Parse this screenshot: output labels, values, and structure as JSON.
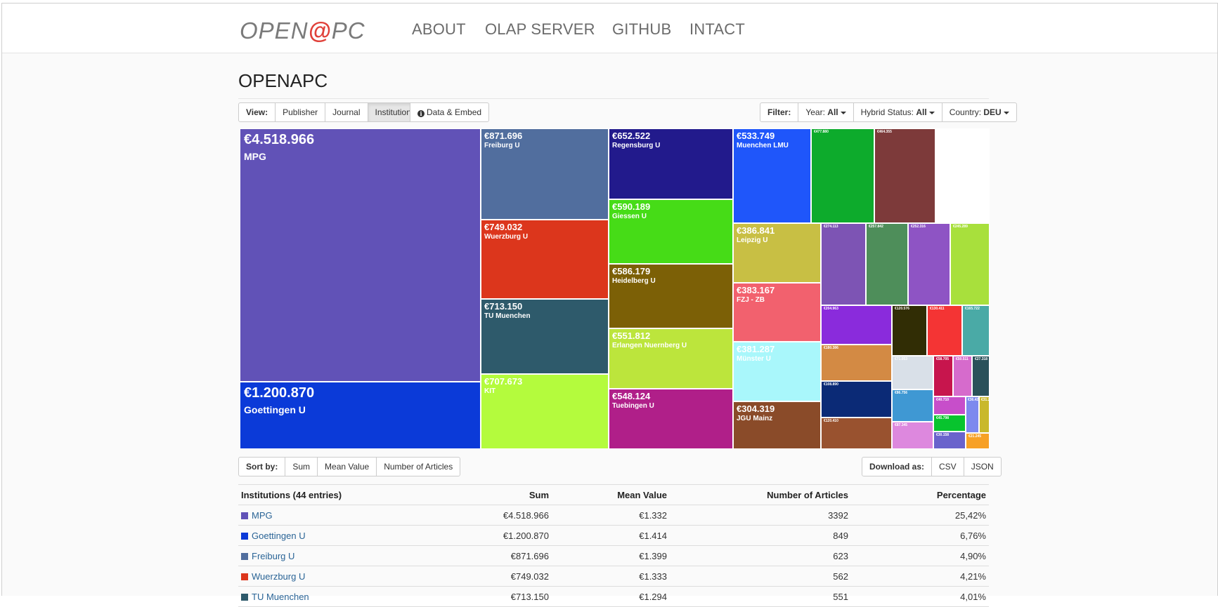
{
  "nav": {
    "logo_left": "OPEN",
    "logo_at": "@",
    "logo_right": "PC",
    "items": [
      "ABOUT",
      "OLAP SERVER",
      "GITHUB",
      "INTACT"
    ]
  },
  "page_title": "OPENAPC",
  "view": {
    "label": "View:",
    "buttons": [
      "Publisher",
      "Journal",
      "Institution"
    ],
    "active": "Institution",
    "data_embed": "Data & Embed"
  },
  "filter": {
    "label": "Filter:",
    "year": {
      "label": "Year:",
      "value": "All"
    },
    "hybrid": {
      "label": "Hybrid Status:",
      "value": "All"
    },
    "country": {
      "label": "Country:",
      "value": "DEU"
    }
  },
  "treemap": {
    "tiles": [
      {
        "amount": "€4.518.966",
        "name": "MPG",
        "color": "#6152b7"
      },
      {
        "amount": "€1.200.870",
        "name": "Goettingen U",
        "color": "#0b3ad8"
      },
      {
        "amount": "€871.696",
        "name": "Freiburg U",
        "color": "#516e9e"
      },
      {
        "amount": "€749.032",
        "name": "Wuerzburg U",
        "color": "#dc361c"
      },
      {
        "amount": "€713.150",
        "name": "TU Muenchen",
        "color": "#2e5a6b"
      },
      {
        "amount": "€707.673",
        "name": "KIT",
        "color": "#b4fb3d"
      },
      {
        "amount": "€652.522",
        "name": "Regensburg U",
        "color": "#221a8c"
      },
      {
        "amount": "€590.189",
        "name": "Giessen U",
        "color": "#46dc17"
      },
      {
        "amount": "€586.179",
        "name": "Heidelberg U",
        "color": "#7c6006"
      },
      {
        "amount": "€551.812",
        "name": "Erlangen Nuernberg U",
        "color": "#bce53c"
      },
      {
        "amount": "€548.124",
        "name": "Tuebingen U",
        "color": "#b01f89"
      },
      {
        "amount": "€533.749",
        "name": "Muenchen LMU",
        "color": "#1f56fa"
      },
      {
        "amount": "€477.880",
        "name": "",
        "color": "#0dab2c"
      },
      {
        "amount": "€464.355",
        "name": "",
        "color": "#7d3a3a"
      },
      {
        "amount": "€386.841",
        "name": "Leipzig U",
        "color": "#c8bf44"
      },
      {
        "amount": "€383.167",
        "name": "FZJ - ZB",
        "color": "#f2616e"
      },
      {
        "amount": "€381.287",
        "name": "Münster U",
        "color": "#a9f7fb"
      },
      {
        "amount": "€304.319",
        "name": "JGU Mainz",
        "color": "#8a4b29"
      },
      {
        "amount": "€274.113",
        "name": "",
        "color": "#7d54b4"
      },
      {
        "amount": "€257.842",
        "name": "",
        "color": "#4e8e5a"
      },
      {
        "amount": "€252.316",
        "name": "",
        "color": "#8e54c4"
      },
      {
        "amount": "€245.289",
        "name": "",
        "color": "#a8e03c"
      },
      {
        "amount": "€204.963",
        "name": "",
        "color": "#8a2bdc"
      },
      {
        "amount": "€120.576",
        "name": "",
        "color": "#312d05"
      },
      {
        "amount": "€130.411",
        "name": "",
        "color": "#f43434"
      },
      {
        "amount": "€165.722",
        "name": "",
        "color": "#4aaaa6"
      },
      {
        "amount": "€180.386",
        "name": "",
        "color": "#d38a44"
      },
      {
        "amount": "€108.890",
        "name": "",
        "color": "#0b2a76"
      },
      {
        "amount": "€120.410",
        "name": "",
        "color": "#99522f"
      },
      {
        "amount": "€71.053",
        "name": "",
        "color": "#d9e0e8"
      },
      {
        "amount": "€58.705",
        "name": "",
        "color": "#c7154d"
      },
      {
        "amount": "€50.511",
        "name": "",
        "color": "#d66bcc"
      },
      {
        "amount": "€27.318",
        "name": "",
        "color": "#2a515a"
      },
      {
        "amount": "€86.756",
        "name": "",
        "color": "#3f98d3"
      },
      {
        "amount": "€75.165",
        "name": "",
        "color": "#c57ad3"
      },
      {
        "amount": "€40.710",
        "name": "",
        "color": "#c74eca"
      },
      {
        "amount": "€45.798",
        "name": "",
        "color": "#08c42e"
      },
      {
        "amount": "€87.345",
        "name": "",
        "color": "#dd88de"
      },
      {
        "amount": "€30.158",
        "name": "",
        "color": "#6a63cc"
      },
      {
        "amount": "€36.429",
        "name": "",
        "color": "#7d89ee"
      },
      {
        "amount": "€31.230",
        "name": "",
        "color": "#c9b82b"
      },
      {
        "amount": "€32.105",
        "name": "",
        "color": "#e0d83a"
      },
      {
        "amount": "€21.245",
        "name": "",
        "color": "#f7a125"
      }
    ]
  },
  "sort": {
    "label": "Sort by:",
    "buttons": [
      "Sum",
      "Mean Value",
      "Number of Articles"
    ]
  },
  "download": {
    "label": "Download as:",
    "buttons": [
      "CSV",
      "JSON"
    ]
  },
  "table": {
    "headers": [
      "Institutions (44 entries)",
      "Sum",
      "Mean Value",
      "Number of Articles",
      "Percentage"
    ],
    "rows": [
      {
        "name": "MPG",
        "color": "#6152b7",
        "sum": "€4.518.966",
        "mean": "€1.332",
        "articles": "3392",
        "pct": "25,42%"
      },
      {
        "name": "Goettingen U",
        "color": "#0b3ad8",
        "sum": "€1.200.870",
        "mean": "€1.414",
        "articles": "849",
        "pct": "6,76%"
      },
      {
        "name": "Freiburg U",
        "color": "#516e9e",
        "sum": "€871.696",
        "mean": "€1.399",
        "articles": "623",
        "pct": "4,90%"
      },
      {
        "name": "Wuerzburg U",
        "color": "#dc361c",
        "sum": "€749.032",
        "mean": "€1.333",
        "articles": "562",
        "pct": "4,21%"
      },
      {
        "name": "TU Muenchen",
        "color": "#2e5a6b",
        "sum": "€713.150",
        "mean": "€1.294",
        "articles": "551",
        "pct": "4,01%"
      }
    ]
  }
}
